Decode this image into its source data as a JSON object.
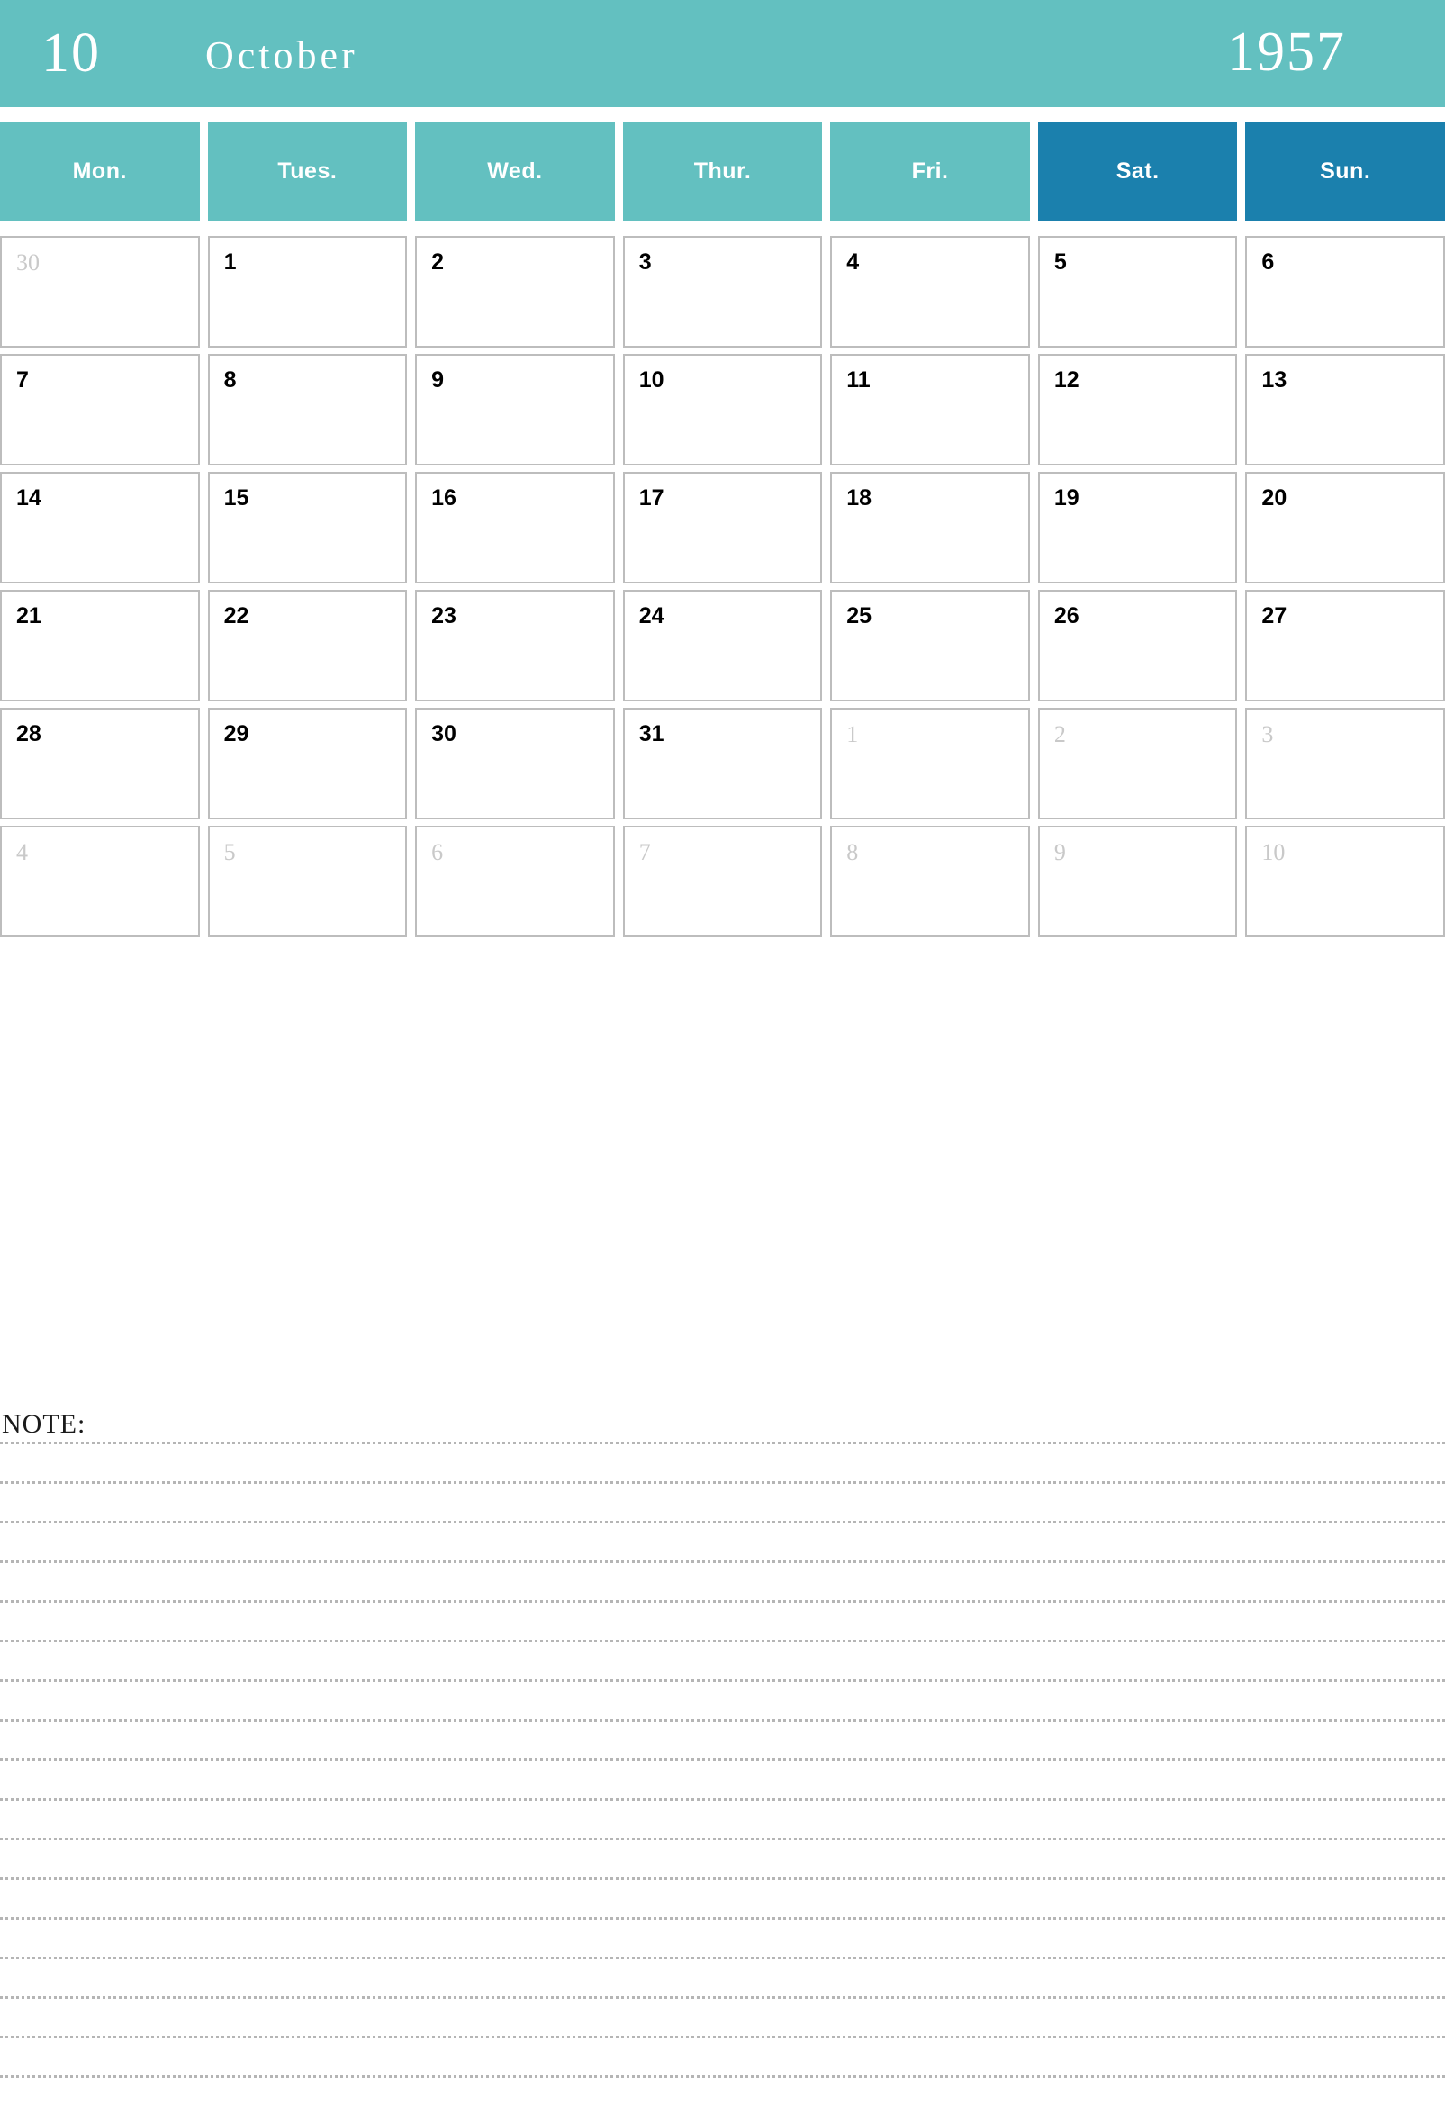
{
  "header": {
    "month_number": "10",
    "month_name": "October",
    "year": "1957"
  },
  "colors": {
    "teal": "#63c0c0",
    "blue": "#1b80ad",
    "cell_border": "#bdbdbd",
    "muted_text": "#c9c9c9",
    "note_line": "#b5b5b5"
  },
  "weekdays": [
    {
      "label": "Mon.",
      "weekend": false
    },
    {
      "label": "Tues.",
      "weekend": false
    },
    {
      "label": "Wed.",
      "weekend": false
    },
    {
      "label": "Thur.",
      "weekend": false
    },
    {
      "label": "Fri.",
      "weekend": false
    },
    {
      "label": "Sat.",
      "weekend": true
    },
    {
      "label": "Sun.",
      "weekend": true
    }
  ],
  "weeks": [
    [
      {
        "day": "30",
        "muted": true
      },
      {
        "day": "1",
        "muted": false
      },
      {
        "day": "2",
        "muted": false
      },
      {
        "day": "3",
        "muted": false
      },
      {
        "day": "4",
        "muted": false
      },
      {
        "day": "5",
        "muted": false
      },
      {
        "day": "6",
        "muted": false
      }
    ],
    [
      {
        "day": "7",
        "muted": false
      },
      {
        "day": "8",
        "muted": false
      },
      {
        "day": "9",
        "muted": false
      },
      {
        "day": "10",
        "muted": false
      },
      {
        "day": "11",
        "muted": false
      },
      {
        "day": "12",
        "muted": false
      },
      {
        "day": "13",
        "muted": false
      }
    ],
    [
      {
        "day": "14",
        "muted": false
      },
      {
        "day": "15",
        "muted": false
      },
      {
        "day": "16",
        "muted": false
      },
      {
        "day": "17",
        "muted": false
      },
      {
        "day": "18",
        "muted": false
      },
      {
        "day": "19",
        "muted": false
      },
      {
        "day": "20",
        "muted": false
      }
    ],
    [
      {
        "day": "21",
        "muted": false
      },
      {
        "day": "22",
        "muted": false
      },
      {
        "day": "23",
        "muted": false
      },
      {
        "day": "24",
        "muted": false
      },
      {
        "day": "25",
        "muted": false
      },
      {
        "day": "26",
        "muted": false
      },
      {
        "day": "27",
        "muted": false
      }
    ],
    [
      {
        "day": "28",
        "muted": false
      },
      {
        "day": "29",
        "muted": false
      },
      {
        "day": "30",
        "muted": false
      },
      {
        "day": "31",
        "muted": false
      },
      {
        "day": "1",
        "muted": true
      },
      {
        "day": "2",
        "muted": true
      },
      {
        "day": "3",
        "muted": true
      }
    ],
    [
      {
        "day": "4",
        "muted": true
      },
      {
        "day": "5",
        "muted": true
      },
      {
        "day": "6",
        "muted": true
      },
      {
        "day": "7",
        "muted": true
      },
      {
        "day": "8",
        "muted": true
      },
      {
        "day": "9",
        "muted": true
      },
      {
        "day": "10",
        "muted": true
      }
    ]
  ],
  "notes": {
    "label": "NOTE:",
    "line_count": 17
  }
}
